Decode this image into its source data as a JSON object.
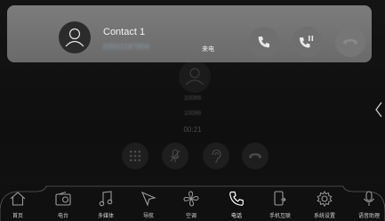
{
  "banner": {
    "contact_name": "Contact 1",
    "contact_number": "03502187856",
    "status": "来电"
  },
  "call": {
    "name": "10086",
    "number": "10086",
    "timer": "00:21"
  },
  "nav": {
    "items": [
      {
        "label": "首页",
        "icon": "home-icon"
      },
      {
        "label": "电台",
        "icon": "radio-icon"
      },
      {
        "label": "多媒体",
        "icon": "music-icon"
      },
      {
        "label": "导航",
        "icon": "navigation-icon"
      },
      {
        "label": "空调",
        "icon": "fan-icon"
      },
      {
        "label": "电话",
        "icon": "phone-icon",
        "active": true
      },
      {
        "label": "手机互联",
        "icon": "phone-link-icon"
      },
      {
        "label": "系统设置",
        "icon": "settings-icon"
      },
      {
        "label": "语音助理",
        "icon": "microphone-icon"
      }
    ]
  },
  "colors": {
    "banner_bg": "#777777",
    "reject_icon": "#8a8a8a",
    "active_nav": "#ffffff",
    "background": "#121212"
  }
}
